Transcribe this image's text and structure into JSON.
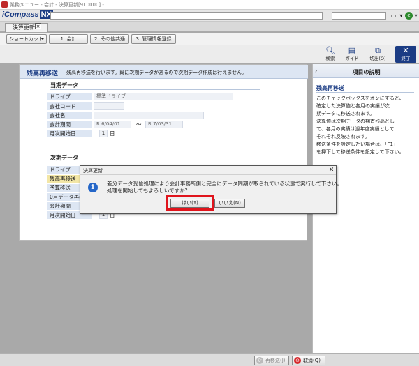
{
  "window": {
    "title": "業務メニュー - 会計 - 決算更新[910000] -"
  },
  "logo": {
    "main": "iCompass",
    "suffix": "NX"
  },
  "tabs": [
    {
      "label": "決算更新"
    }
  ],
  "shortcut_toolbar": {
    "dropdown_label": "ショートカット",
    "buttons": [
      "1. 会計",
      "2. その他共通",
      "3. 管理情報登録"
    ]
  },
  "function_bar": {
    "buttons": [
      {
        "label": "検索",
        "icon": "magnifier-icon"
      },
      {
        "label": "ガイド",
        "icon": "guide-book-icon"
      },
      {
        "label": "切出(O)",
        "icon": "windows-icon"
      },
      {
        "label": "終了",
        "icon": "close-x-icon"
      }
    ]
  },
  "panel": {
    "title": "残高再移送",
    "description": "残高再移送を行います。既に次期データがあるので次期データ作成は行えません。",
    "current": {
      "section": "当期データ",
      "drive_label": "ドライブ",
      "drive_value": "標準ドライブ",
      "company_code_label": "会社コード",
      "company_name_label": "会社名",
      "period_label": "会計期間",
      "period_start": "R 6/04/01",
      "period_sep": "〜",
      "period_end": "R 7/03/31",
      "month_start_label": "月次開始日",
      "month_start_value": "1",
      "day_unit": "日"
    },
    "next": {
      "section": "次期データ",
      "labels": [
        "ドライブ",
        "残高再移送",
        "予算移送",
        "0月データ再移",
        "会計期間",
        "月次開始日"
      ],
      "month_start_value": "1",
      "day_unit": "日"
    }
  },
  "help": {
    "title": "項目の説明",
    "subtitle": "残高再移送",
    "lines": [
      "このチェックボックスをオンにすると、",
      "確定した決算値と各月の実績が次",
      "期データに移送されます。",
      "決算値は次期データの期首残高とし",
      "て、各月の実績は過年度実績として",
      "それぞれ反映されます。",
      "移送条件を設定したい場合は、「F1」",
      "を押下して移送条件を設定して下さい。"
    ]
  },
  "dialog": {
    "title": "決算更新",
    "message_line1": "差分データ受信処理により会計事務所側と完全にデータ同期が取られている状態で実行して下さい。",
    "message_line2": "処理を開始してもよろしいですか？",
    "yes_label": "はい(Y)",
    "no_label": "いいえ(N)",
    "highlight_color": "#e0141c"
  },
  "bottom_bar": {
    "retransfer_label": "再移送(J)",
    "cancel_label": "取消(Q)"
  },
  "colors": {
    "brand": "#1b3c84",
    "header_band": "#dde6f3",
    "cancel_icon": "#d6262a"
  }
}
